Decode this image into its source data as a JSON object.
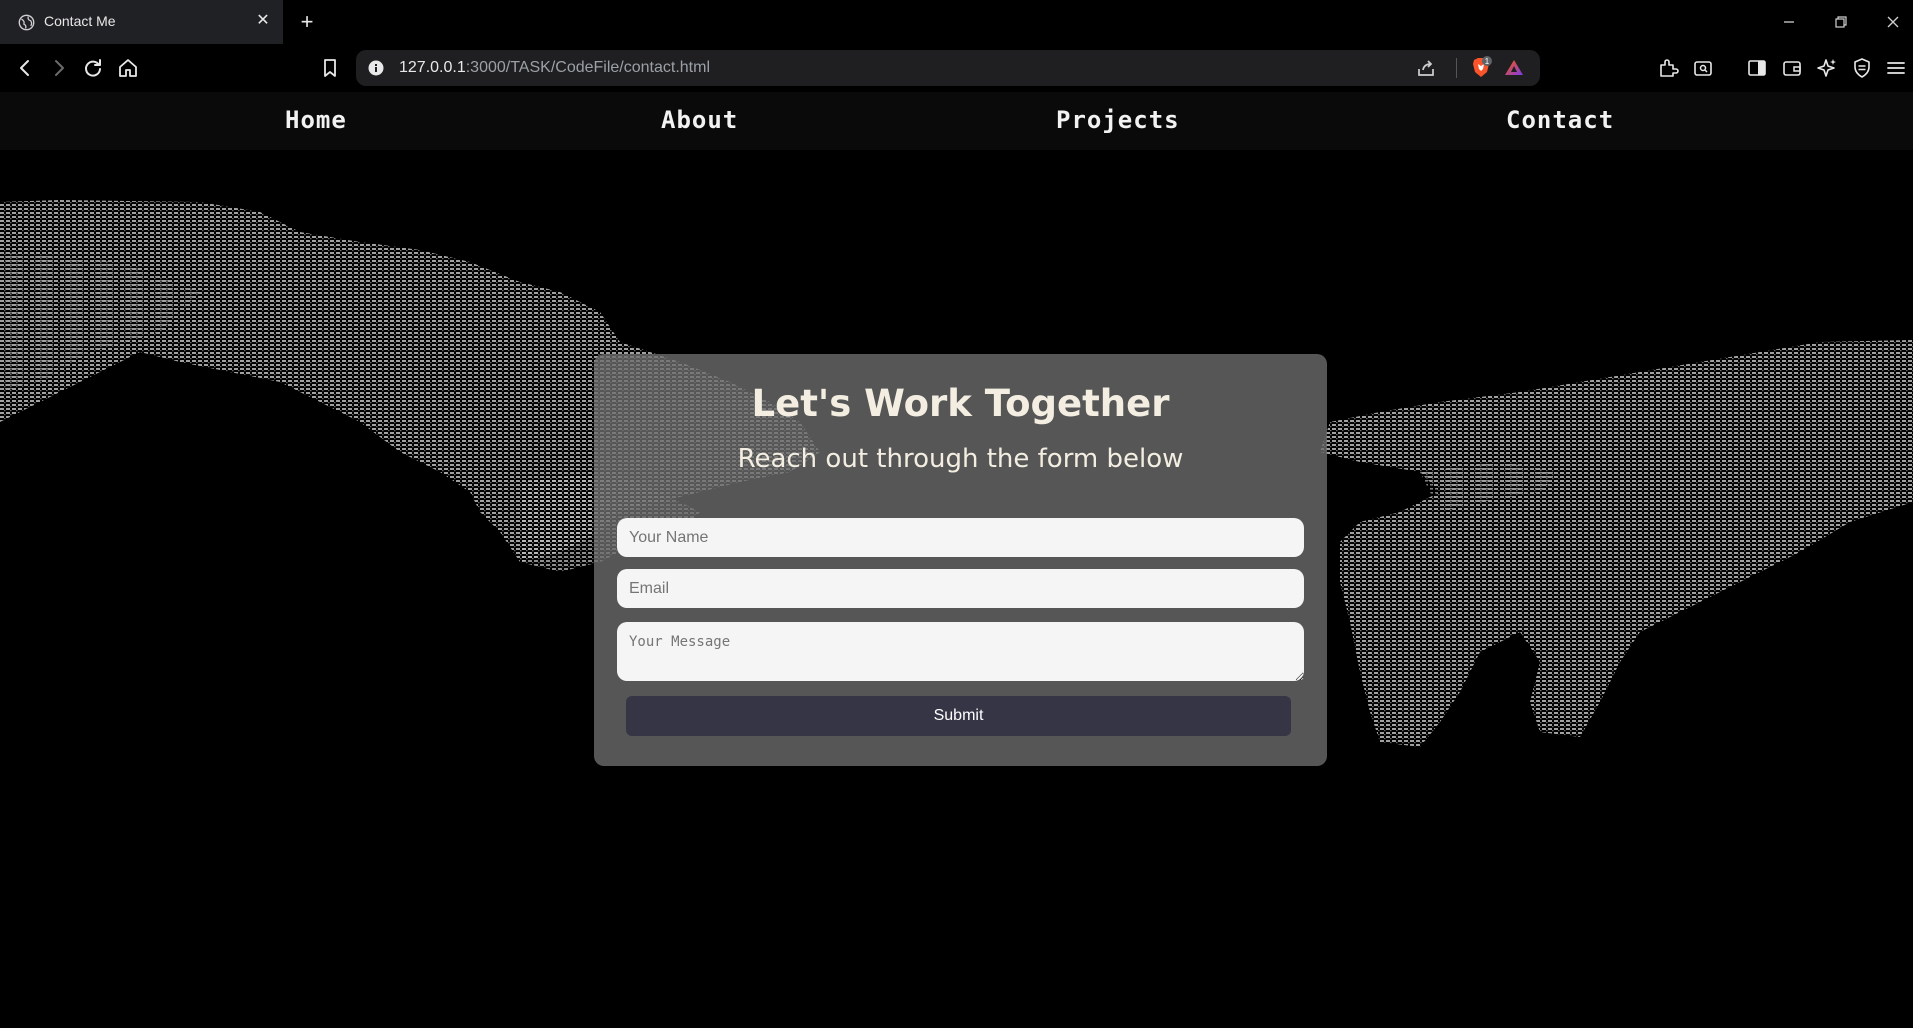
{
  "browser": {
    "tab_title": "Contact Me",
    "url_host": "127.0.0.1",
    "url_rest": ":3000/TASK/CodeFile/contact.html",
    "shields_badge": "1",
    "accent": "#fb542b"
  },
  "nav": {
    "home": "Home",
    "about": "About",
    "projects": "Projects",
    "contact": "Contact"
  },
  "contact": {
    "title": "Let's Work Together",
    "subtitle": "Reach out through the form below",
    "name_placeholder": "Your Name",
    "email_placeholder": "Email",
    "message_placeholder": "Your Message",
    "submit_label": "Submit",
    "card_color": "#6e6e6e",
    "button_color": "#353546"
  }
}
